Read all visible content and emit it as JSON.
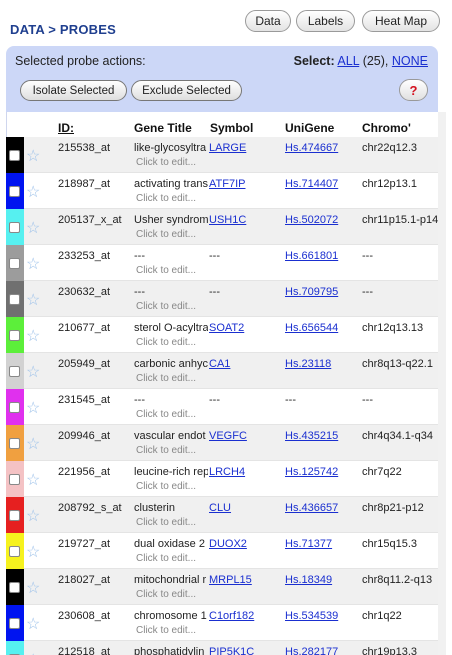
{
  "header": {
    "breadcrumb": "DATA > PROBES",
    "tabs": [
      {
        "label": "Data"
      },
      {
        "label": "Labels"
      },
      {
        "label": "Heat Map"
      }
    ]
  },
  "actions": {
    "title": "Selected probe actions:",
    "select_label": "Select:",
    "select_all": "ALL",
    "select_count": "(25),",
    "select_none": "NONE",
    "isolate_label": "Isolate Selected",
    "exclude_label": "Exclude Selected",
    "help_label": "?"
  },
  "table": {
    "columns": {
      "id": "ID:",
      "gene_title": "Gene Title",
      "symbol": "Symbol",
      "unigene": "UniGene",
      "chromo": "Chromo'"
    },
    "edit_placeholder": "Click to edit...",
    "rows": [
      {
        "color": "#000000",
        "id": "215538_at",
        "gene_title": "like-glycosyltra",
        "symbol": "LARGE",
        "unigene": "Hs.474667",
        "chromo": "chr22q12.3"
      },
      {
        "color": "#0014f0",
        "id": "218987_at",
        "gene_title": "activating trans",
        "symbol": "ATF7IP",
        "unigene": "Hs.714407",
        "chromo": "chr12p13.1"
      },
      {
        "color": "#56f0f0",
        "id": "205137_x_at",
        "gene_title": "Usher syndrom",
        "symbol": "USH1C",
        "unigene": "Hs.502072",
        "chromo": "chr11p15.1-p14"
      },
      {
        "color": "#9c9c9c",
        "id": "233253_at",
        "gene_title": "---",
        "symbol": "---",
        "unigene": "Hs.661801",
        "chromo": "---"
      },
      {
        "color": "#707070",
        "id": "230632_at",
        "gene_title": "---",
        "symbol": "---",
        "unigene": "Hs.709795",
        "chromo": "---"
      },
      {
        "color": "#5cef3a",
        "id": "210677_at",
        "gene_title": "sterol O-acyltra",
        "symbol": "SOAT2",
        "unigene": "Hs.656544",
        "chromo": "chr12q13.13"
      },
      {
        "color": "#d2d2d2",
        "id": "205949_at",
        "gene_title": "carbonic anhyc",
        "symbol": "CA1",
        "unigene": "Hs.23118",
        "chromo": "chr8q13-q22.1"
      },
      {
        "color": "#e030ee",
        "id": "231545_at",
        "gene_title": "---",
        "symbol": "---",
        "unigene": "---",
        "chromo": "---"
      },
      {
        "color": "#f0a040",
        "id": "209946_at",
        "gene_title": "vascular endot",
        "symbol": "VEGFC",
        "unigene": "Hs.435215",
        "chromo": "chr4q34.1-q34"
      },
      {
        "color": "#f4c2c4",
        "id": "221956_at",
        "gene_title": "leucine-rich rep",
        "symbol": "LRCH4",
        "unigene": "Hs.125742",
        "chromo": "chr7q22"
      },
      {
        "color": "#e62020",
        "id": "208792_s_at",
        "gene_title": "clusterin",
        "symbol": "CLU",
        "unigene": "Hs.436657",
        "chromo": "chr8p21-p12"
      },
      {
        "color": "#f6f21e",
        "id": "219727_at",
        "gene_title": "dual oxidase 2",
        "symbol": "DUOX2",
        "unigene": "Hs.71377",
        "chromo": "chr15q15.3"
      },
      {
        "color": "#000000",
        "id": "218027_at",
        "gene_title": "mitochondrial r",
        "symbol": "MRPL15",
        "unigene": "Hs.18349",
        "chromo": "chr8q11.2-q13"
      },
      {
        "color": "#0014f0",
        "id": "230608_at",
        "gene_title": "chromosome 1",
        "symbol": "C1orf182",
        "unigene": "Hs.534539",
        "chromo": "chr1q22"
      },
      {
        "color": "#56f0f0",
        "id": "212518_at",
        "gene_title": "phosphatidylin",
        "symbol": "PIP5K1C",
        "unigene": "Hs.282177",
        "chromo": "chr19p13.3"
      }
    ]
  }
}
